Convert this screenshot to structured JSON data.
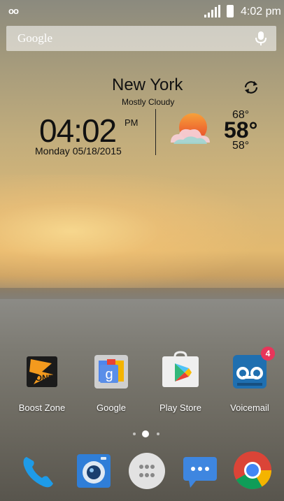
{
  "status_bar": {
    "voicemail_icon": "oo",
    "time": "4:02 pm"
  },
  "search": {
    "placeholder": "Google",
    "mic_icon": "mic-icon"
  },
  "weather": {
    "city": "New York",
    "condition": "Mostly Cloudy",
    "time": "04:02",
    "ampm": "PM",
    "date": "Monday  05/18/2015",
    "high": "68°",
    "current": "58°",
    "low": "58°"
  },
  "apps": [
    {
      "label": "Boost Zone"
    },
    {
      "label": "Google"
    },
    {
      "label": "Play Store"
    },
    {
      "label": "Voicemail",
      "badge": "4"
    }
  ],
  "dock": [
    "phone-icon",
    "camera-icon",
    "app-drawer-icon",
    "messaging-icon",
    "chrome-icon"
  ],
  "colors": {
    "accent_badge": "#e8355a",
    "boost_orange": "#f39a1e"
  }
}
